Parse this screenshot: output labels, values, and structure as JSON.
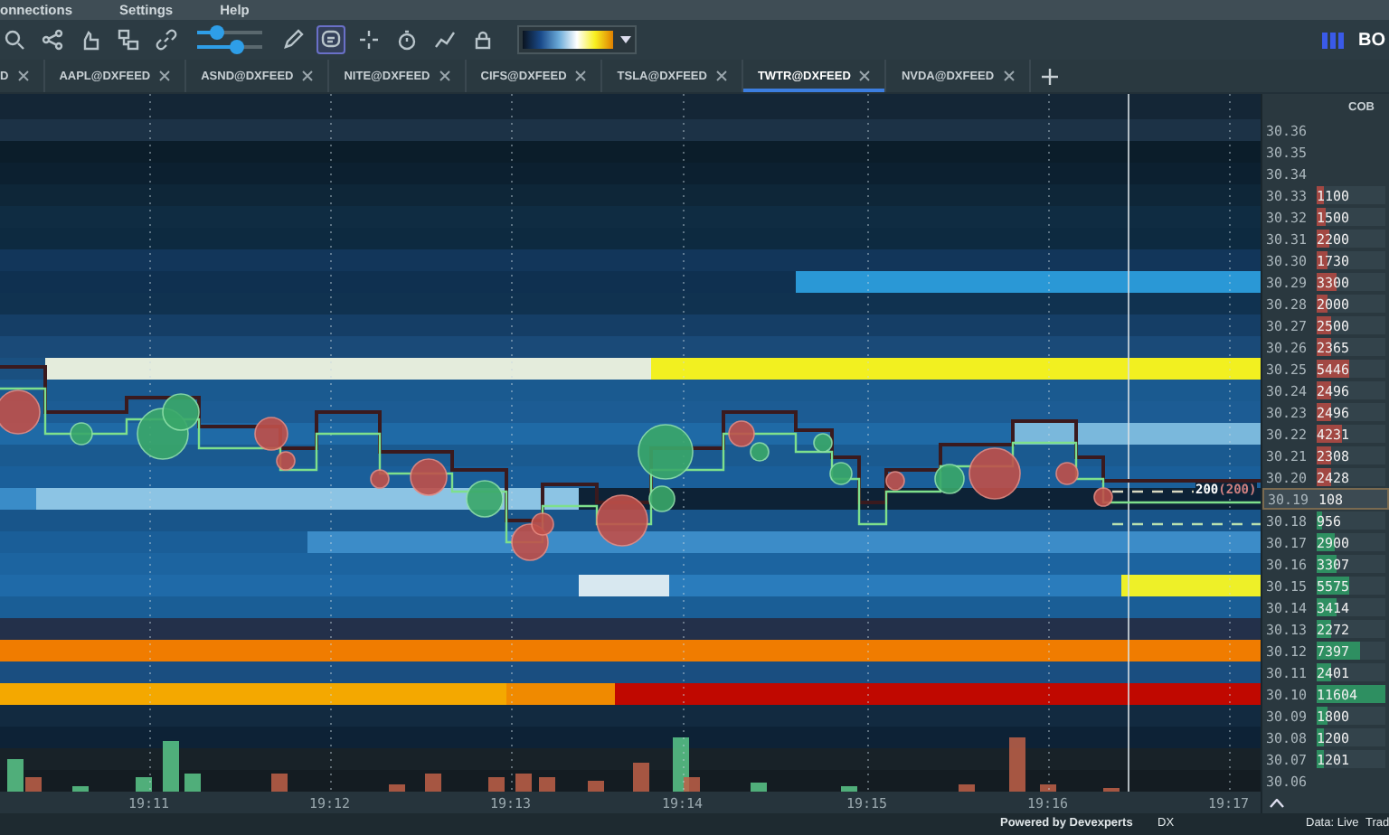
{
  "menu": [
    {
      "label": "onnections"
    },
    {
      "label": "Settings"
    },
    {
      "label": "Help"
    }
  ],
  "toolbar": {
    "tools_left": [
      {
        "kind": "search",
        "selected": false
      },
      {
        "kind": "share",
        "selected": false
      },
      {
        "kind": "hand",
        "selected": false
      },
      {
        "kind": "layers",
        "selected": false
      },
      {
        "kind": "link",
        "selected": false
      }
    ],
    "sliders": [
      {
        "level": 0.3
      },
      {
        "level": 0.6
      }
    ],
    "tools_right": [
      {
        "kind": "pencil",
        "selected": false
      },
      {
        "kind": "chat",
        "selected": true
      },
      {
        "kind": "crosshair",
        "selected": false
      },
      {
        "kind": "timer",
        "selected": false
      },
      {
        "kind": "chart",
        "selected": false
      },
      {
        "kind": "lock",
        "selected": false
      }
    ],
    "brand": "BO"
  },
  "tabs": [
    {
      "label": "D",
      "selected": false
    },
    {
      "label": "AAPL@DXFEED",
      "selected": false
    },
    {
      "label": "ASND@DXFEED",
      "selected": false
    },
    {
      "label": "NITE@DXFEED",
      "selected": false
    },
    {
      "label": "CIFS@DXFEED",
      "selected": false
    },
    {
      "label": "TSLA@DXFEED",
      "selected": false
    },
    {
      "label": "TWTR@DXFEED",
      "selected": true
    },
    {
      "label": "NVDA@DXFEED",
      "selected": false
    }
  ],
  "chart": {
    "time_labels": [
      "19:11",
      "19:12",
      "19:13",
      "19:14",
      "19:15",
      "19:16",
      "19:17"
    ],
    "order_size": "200",
    "order_filled": "(200)"
  },
  "ladder": {
    "header": "COB",
    "rows": [
      {
        "price": "30.36",
        "kind": "none",
        "current": false
      },
      {
        "price": "30.35",
        "kind": "none",
        "current": false
      },
      {
        "price": "30.34",
        "kind": "none",
        "current": false
      },
      {
        "price": "30.33",
        "size": "1100",
        "kind": "ask",
        "level": 0.1,
        "current": false
      },
      {
        "price": "30.32",
        "size": "1500",
        "kind": "ask",
        "level": 0.13,
        "current": false
      },
      {
        "price": "30.31",
        "size": "2200",
        "kind": "ask",
        "level": 0.19,
        "current": false
      },
      {
        "price": "30.30",
        "size": "1730",
        "kind": "ask",
        "level": 0.15,
        "current": false
      },
      {
        "price": "30.29",
        "size": "3300",
        "kind": "ask",
        "level": 0.28,
        "current": false
      },
      {
        "price": "30.28",
        "size": "2000",
        "kind": "ask",
        "level": 0.17,
        "current": false
      },
      {
        "price": "30.27",
        "size": "2500",
        "kind": "ask",
        "level": 0.22,
        "current": false
      },
      {
        "price": "30.26",
        "size": "2365",
        "kind": "ask",
        "level": 0.2,
        "current": false
      },
      {
        "price": "30.25",
        "size": "5446",
        "kind": "ask",
        "level": 0.47,
        "current": false
      },
      {
        "price": "30.24",
        "size": "2496",
        "kind": "ask",
        "level": 0.22,
        "current": false
      },
      {
        "price": "30.23",
        "size": "2496",
        "kind": "ask",
        "level": 0.22,
        "current": false
      },
      {
        "price": "30.22",
        "size": "4231",
        "kind": "ask",
        "level": 0.36,
        "current": false
      },
      {
        "price": "30.21",
        "size": "2308",
        "kind": "ask",
        "level": 0.2,
        "current": false
      },
      {
        "price": "30.20",
        "size": "2428",
        "kind": "ask",
        "level": 0.21,
        "current": false
      },
      {
        "price": "30.19",
        "size": "108",
        "kind": "none",
        "current": true
      },
      {
        "price": "30.18",
        "size": "956",
        "kind": "bid",
        "level": 0.08,
        "current": false
      },
      {
        "price": "30.17",
        "size": "2900",
        "kind": "bid",
        "level": 0.25,
        "current": false
      },
      {
        "price": "30.16",
        "size": "3307",
        "kind": "bid",
        "level": 0.28,
        "current": false
      },
      {
        "price": "30.15",
        "size": "5575",
        "kind": "bid",
        "level": 0.48,
        "current": false
      },
      {
        "price": "30.14",
        "size": "3414",
        "kind": "bid",
        "level": 0.29,
        "current": false
      },
      {
        "price": "30.13",
        "size": "2272",
        "kind": "bid",
        "level": 0.2,
        "current": false
      },
      {
        "price": "30.12",
        "size": "7397",
        "kind": "bid",
        "level": 0.64,
        "current": false
      },
      {
        "price": "30.11",
        "size": "2401",
        "kind": "bid",
        "level": 0.21,
        "current": false
      },
      {
        "price": "30.10",
        "size": "11604",
        "kind": "bid",
        "level": 1,
        "current": false
      },
      {
        "price": "30.09",
        "size": "1800",
        "kind": "bid",
        "level": 0.16,
        "current": false
      },
      {
        "price": "30.08",
        "size": "1200",
        "kind": "bid",
        "level": 0.1,
        "current": false
      },
      {
        "price": "30.07",
        "size": "1201",
        "kind": "bid",
        "level": 0.1,
        "current": false
      },
      {
        "price": "30.06",
        "kind": "none",
        "current": false
      }
    ]
  },
  "status_bar": {
    "powered": "Powered by Devexperts",
    "source": "DX",
    "data": "Data: Live",
    "trade": "Trad"
  }
}
